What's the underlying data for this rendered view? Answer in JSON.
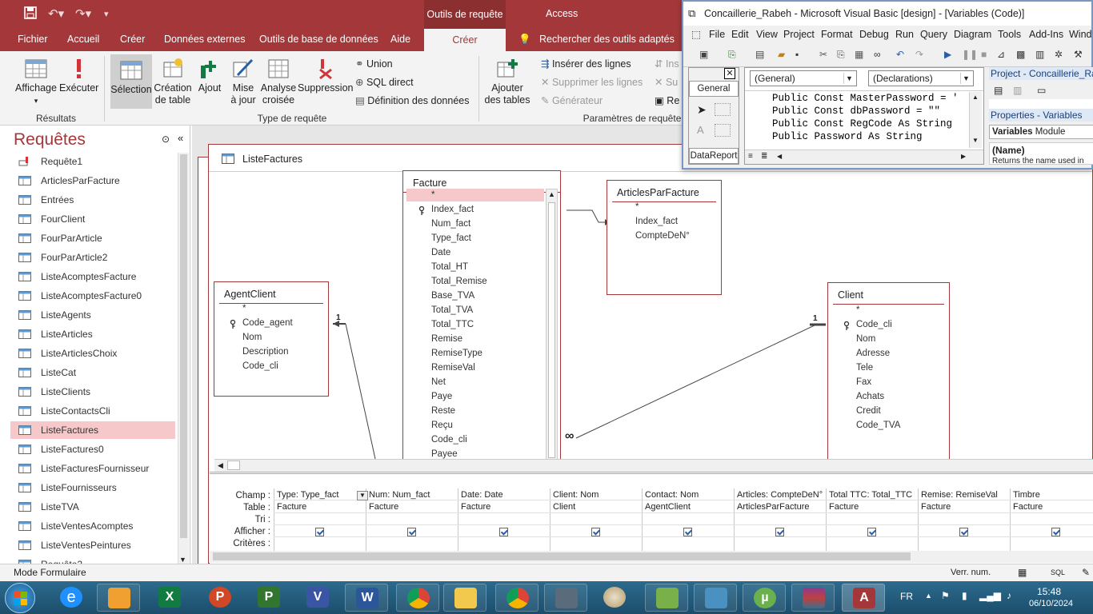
{
  "titlebar": {
    "context_tab": "Outils de requête",
    "app": "Access"
  },
  "tabs": [
    {
      "label": "Fichier"
    },
    {
      "label": "Accueil"
    },
    {
      "label": "Créer"
    },
    {
      "label": "Données externes"
    },
    {
      "label": "Outils de base de données"
    },
    {
      "label": "Aide"
    },
    {
      "label": "Créer"
    },
    {
      "label": "Rechercher des outils adaptés"
    }
  ],
  "ribbon": {
    "affichage": "Affichage",
    "executer": "Exécuter",
    "resultats": "Résultats",
    "selection": "Sélection",
    "creation": "Création",
    "de_table": "de table",
    "ajout": "Ajout",
    "mise": "Mise",
    "a_jour": "à jour",
    "analyse": "Analyse",
    "croisee": "croisée",
    "suppression": "Suppression",
    "union": "Union",
    "sql": "SQL direct",
    "definition": "Définition des données",
    "type_requete": "Type de requête",
    "ajouter": "Ajouter",
    "des_tables": "des tables",
    "inserer": "Insérer des lignes",
    "supprimer": "Supprimer les lignes",
    "generateur": "Générateur",
    "parametres": "Paramètres de requête",
    "ins": "Ins",
    "su": "Su",
    "re": "Re"
  },
  "nav": {
    "title": "Requêtes",
    "items": [
      "Requête1",
      "ArticlesParFacture",
      "Entrées",
      "FourClient",
      "FourParArticle",
      "FourParArticle2",
      "ListeAcomptesFacture",
      "ListeAcomptesFacture0",
      "ListeAgents",
      "ListeArticles",
      "ListeArticlesChoix",
      "ListeCat",
      "ListeClients",
      "ListeContactsCli",
      "ListeFactures",
      "ListeFactures0",
      "ListeFacturesFournisseur",
      "ListeFournisseurs",
      "ListeTVA",
      "ListeVentesAcomptes",
      "ListeVentesPeintures",
      "Requête2"
    ],
    "selected": "ListeFactures"
  },
  "doc": {
    "title": "ListeFactures"
  },
  "tables": {
    "facture": {
      "name": "Facture",
      "fields": [
        "*",
        "Index_fact",
        "Num_fact",
        "Type_fact",
        "Date",
        "Total_HT",
        "Total_Remise",
        "Base_TVA",
        "Total_TVA",
        "Total_TTC",
        "Remise",
        "RemiseType",
        "RemiseVal",
        "Net",
        "Paye",
        "Reste",
        "Reçu",
        "Code_cli",
        "Payee"
      ]
    },
    "articles": {
      "name": "ArticlesParFacture",
      "fields": [
        "*",
        "Index_fact",
        "CompteDeN°"
      ]
    },
    "agent": {
      "name": "AgentClient",
      "fields": [
        "*",
        "Code_agent",
        "Nom",
        "Description",
        "Code_cli"
      ]
    },
    "client": {
      "name": "Client",
      "fields": [
        "*",
        "Code_cli",
        "Nom",
        "Adresse",
        "Tele",
        "Fax",
        "Achats",
        "Credit",
        "Code_TVA"
      ]
    },
    "rel_one": "1",
    "rel_many": "∞"
  },
  "grid": {
    "row_labels": [
      "Champ :",
      "Table :",
      "Tri :",
      "Afficher :",
      "Critères :"
    ],
    "columns": [
      {
        "field": "Type: Type_fact",
        "table": "Facture"
      },
      {
        "field": "Num: Num_fact",
        "table": "Facture"
      },
      {
        "field": "Date: Date",
        "table": "Facture"
      },
      {
        "field": "Client: Nom",
        "table": "Client"
      },
      {
        "field": "Contact: Nom",
        "table": "AgentClient"
      },
      {
        "field": "Articles: CompteDeN°",
        "table": "ArticlesParFacture"
      },
      {
        "field": "Total TTC: Total_TTC",
        "table": "Facture"
      },
      {
        "field": "Remise: RemiseVal",
        "table": "Facture"
      },
      {
        "field": "Timbre",
        "table": "Facture"
      }
    ]
  },
  "status": {
    "mode": "Mode Formulaire",
    "verr": "Verr. num.",
    "sql": "SQL"
  },
  "taskbar": {
    "lang": "FR",
    "time": "15:48",
    "date": "06/10/2024"
  },
  "vb": {
    "title": "Concaillerie_Rabeh - Microsoft Visual Basic [design] - [Variables (Code)]",
    "menu": [
      "File",
      "Edit",
      "View",
      "Project",
      "Format",
      "Debug",
      "Run",
      "Query",
      "Diagram",
      "Tools",
      "Add-Ins",
      "Wind"
    ],
    "general_tab": "General",
    "combo_left": "(General)",
    "combo_right": "(Declarations)",
    "code": [
      "Public Const MasterPassword = '",
      "Public Const dbPassword = \"\"",
      "Public Const RegCode As String",
      "Public Password As String"
    ],
    "project_title": "Project - Concaillerie_Ra",
    "properties_title": "Properties - Variables",
    "prop_object": "Variables",
    "prop_type": "Module",
    "prop_name": "(Name)",
    "prop_desc": "Returns the name used in",
    "datareport": "DataReport"
  }
}
